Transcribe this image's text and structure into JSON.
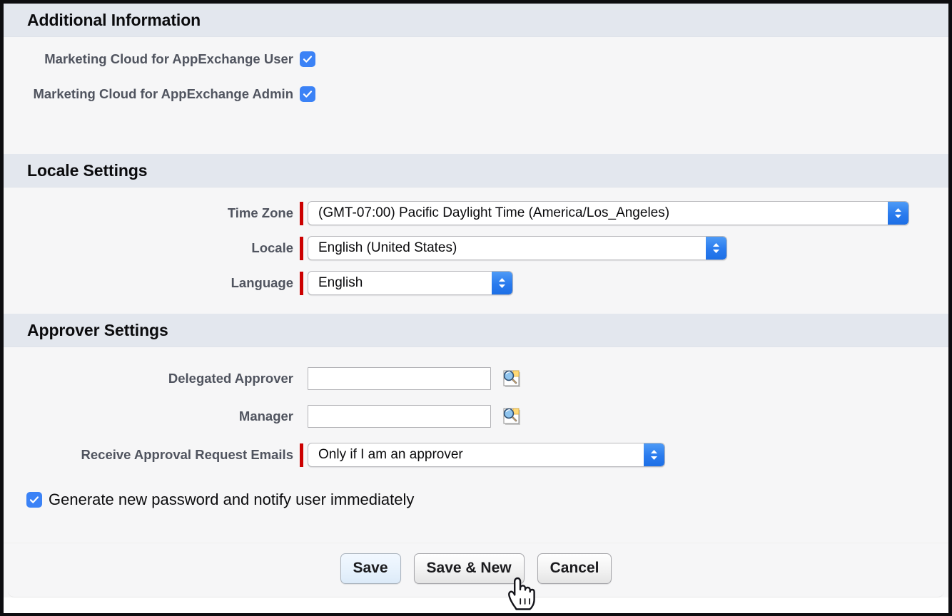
{
  "sections": [
    {
      "id": "additional-information",
      "title": "Additional Information",
      "fields": [
        {
          "label": "Marketing Cloud for AppExchange User",
          "type": "checkbox",
          "checked": true
        },
        {
          "label": "Marketing Cloud for AppExchange Admin",
          "type": "checkbox",
          "checked": true
        }
      ]
    },
    {
      "id": "locale-settings",
      "title": "Locale Settings",
      "fields": [
        {
          "label": "Time Zone",
          "type": "select",
          "value": "(GMT-07:00) Pacific Daylight Time (America/Los_Angeles)",
          "required": true
        },
        {
          "label": "Locale",
          "type": "select",
          "value": "English (United States)",
          "required": true
        },
        {
          "label": "Language",
          "type": "select",
          "value": "English",
          "required": true
        }
      ]
    },
    {
      "id": "approver-settings",
      "title": "Approver Settings",
      "fields": [
        {
          "label": "Delegated Approver",
          "type": "lookup",
          "value": "",
          "required": false
        },
        {
          "label": "Manager",
          "type": "lookup",
          "value": "",
          "required": false
        },
        {
          "label": "Receive Approval Request Emails",
          "type": "select",
          "value": "Only if I am an approver",
          "required": true
        }
      ]
    }
  ],
  "generate_password": {
    "label": "Generate new password and notify user immediately",
    "checked": true
  },
  "buttons": {
    "save": "Save",
    "save_and_new": "Save & New",
    "cancel": "Cancel"
  },
  "icons": {
    "lookup": "lookup-search-icon",
    "stepper": "stepper-up-down-icon",
    "check": "checkmark-icon",
    "cursor": "pointing-hand-cursor"
  },
  "colors": {
    "section_header_bg": "#e3e7ee",
    "body_bg": "#f6f6f7",
    "required_marker": "#cc0000",
    "checkbox_blue": "#3b82f6",
    "stepper_blue": "#2a7bee",
    "label_text": "#50545f"
  }
}
